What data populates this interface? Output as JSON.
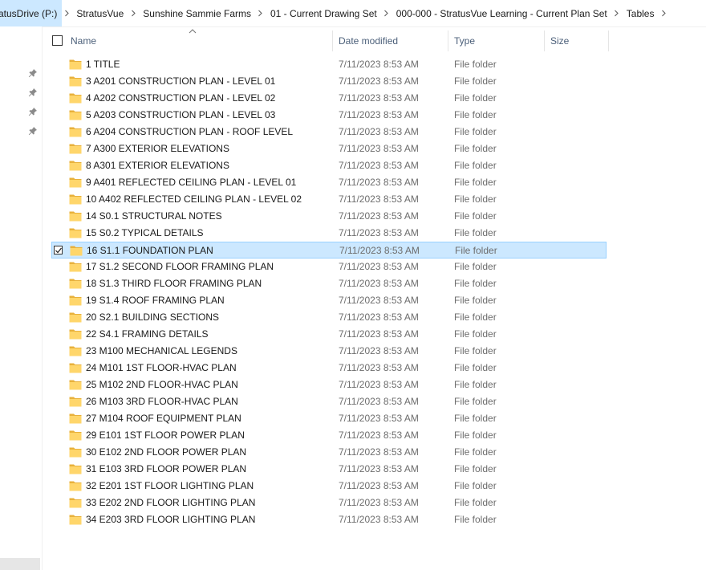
{
  "breadcrumb": [
    {
      "label": "ratusDrive (P:)"
    },
    {
      "label": "StratusVue"
    },
    {
      "label": "Sunshine Sammie Farms"
    },
    {
      "label": "01 - Current Drawing Set"
    },
    {
      "label": "000-000 - StratusVue Learning - Current Plan Set"
    },
    {
      "label": "Tables"
    }
  ],
  "columns": {
    "name": "Name",
    "date_modified": "Date modified",
    "type": "Type",
    "size": "Size",
    "sorted_by": "name",
    "sort_direction": "ascending"
  },
  "files": [
    {
      "name": "1 TITLE",
      "date": "7/11/2023 8:53 AM",
      "type": "File folder",
      "selected": false
    },
    {
      "name": "3 A201 CONSTRUCTION PLAN - LEVEL 01",
      "date": "7/11/2023 8:53 AM",
      "type": "File folder",
      "selected": false
    },
    {
      "name": "4 A202 CONSTRUCTION PLAN - LEVEL 02",
      "date": "7/11/2023 8:53 AM",
      "type": "File folder",
      "selected": false
    },
    {
      "name": "5 A203 CONSTRUCTION PLAN - LEVEL 03",
      "date": "7/11/2023 8:53 AM",
      "type": "File folder",
      "selected": false
    },
    {
      "name": "6 A204 CONSTRUCTION PLAN - ROOF LEVEL",
      "date": "7/11/2023 8:53 AM",
      "type": "File folder",
      "selected": false
    },
    {
      "name": "7 A300 EXTERIOR ELEVATIONS",
      "date": "7/11/2023 8:53 AM",
      "type": "File folder",
      "selected": false
    },
    {
      "name": "8 A301 EXTERIOR ELEVATIONS",
      "date": "7/11/2023 8:53 AM",
      "type": "File folder",
      "selected": false
    },
    {
      "name": "9 A401 REFLECTED CEILING PLAN - LEVEL 01",
      "date": "7/11/2023 8:53 AM",
      "type": "File folder",
      "selected": false
    },
    {
      "name": "10 A402 REFLECTED CEILING PLAN - LEVEL 02",
      "date": "7/11/2023 8:53 AM",
      "type": "File folder",
      "selected": false
    },
    {
      "name": "14 S0.1 STRUCTURAL NOTES",
      "date": "7/11/2023 8:53 AM",
      "type": "File folder",
      "selected": false
    },
    {
      "name": "15 S0.2 TYPICAL DETAILS",
      "date": "7/11/2023 8:53 AM",
      "type": "File folder",
      "selected": false
    },
    {
      "name": "16 S1.1 FOUNDATION PLAN",
      "date": "7/11/2023 8:53 AM",
      "type": "File folder",
      "selected": true
    },
    {
      "name": "17 S1.2 SECOND FLOOR FRAMING PLAN",
      "date": "7/11/2023 8:53 AM",
      "type": "File folder",
      "selected": false
    },
    {
      "name": "18 S1.3 THIRD FLOOR FRAMING PLAN",
      "date": "7/11/2023 8:53 AM",
      "type": "File folder",
      "selected": false
    },
    {
      "name": "19 S1.4 ROOF FRAMING PLAN",
      "date": "7/11/2023 8:53 AM",
      "type": "File folder",
      "selected": false
    },
    {
      "name": "20 S2.1 BUILDING SECTIONS",
      "date": "7/11/2023 8:53 AM",
      "type": "File folder",
      "selected": false
    },
    {
      "name": "22 S4.1 FRAMING DETAILS",
      "date": "7/11/2023 8:53 AM",
      "type": "File folder",
      "selected": false
    },
    {
      "name": "23 M100 MECHANICAL LEGENDS",
      "date": "7/11/2023 8:53 AM",
      "type": "File folder",
      "selected": false
    },
    {
      "name": "24 M101 1ST FLOOR-HVAC PLAN",
      "date": "7/11/2023 8:53 AM",
      "type": "File folder",
      "selected": false
    },
    {
      "name": "25 M102 2ND FLOOR-HVAC PLAN",
      "date": "7/11/2023 8:53 AM",
      "type": "File folder",
      "selected": false
    },
    {
      "name": "26 M103 3RD FLOOR-HVAC PLAN",
      "date": "7/11/2023 8:53 AM",
      "type": "File folder",
      "selected": false
    },
    {
      "name": "27 M104 ROOF EQUIPMENT PLAN",
      "date": "7/11/2023 8:53 AM",
      "type": "File folder",
      "selected": false
    },
    {
      "name": "29 E101 1ST FLOOR POWER PLAN",
      "date": "7/11/2023 8:53 AM",
      "type": "File folder",
      "selected": false
    },
    {
      "name": "30 E102 2ND FLOOR POWER PLAN",
      "date": "7/11/2023 8:53 AM",
      "type": "File folder",
      "selected": false
    },
    {
      "name": "31 E103 3RD FLOOR POWER PLAN",
      "date": "7/11/2023 8:53 AM",
      "type": "File folder",
      "selected": false
    },
    {
      "name": "32 E201 1ST FLOOR LIGHTING PLAN",
      "date": "7/11/2023 8:53 AM",
      "type": "File folder",
      "selected": false
    },
    {
      "name": "33 E202 2ND FLOOR LIGHTING PLAN",
      "date": "7/11/2023 8:53 AM",
      "type": "File folder",
      "selected": false
    },
    {
      "name": "34 E203 3RD FLOOR LIGHTING PLAN",
      "date": "7/11/2023 8:53 AM",
      "type": "File folder",
      "selected": false
    }
  ],
  "navpane": {
    "pinned_count": 4
  },
  "colors": {
    "selection_bg": "#cce8ff",
    "selection_border": "#99d1ff",
    "folder_yellow": "#ffd66b",
    "folder_dark": "#e8b13c",
    "header_text": "#4c607a",
    "secondary_text": "#6d6d6d"
  },
  "icons": {
    "folder": "folder-icon",
    "pin": "pin-icon",
    "separator": "chevron-right-icon",
    "sort": "sort-up-caret-icon",
    "checkbox": "checkbox-icon"
  }
}
